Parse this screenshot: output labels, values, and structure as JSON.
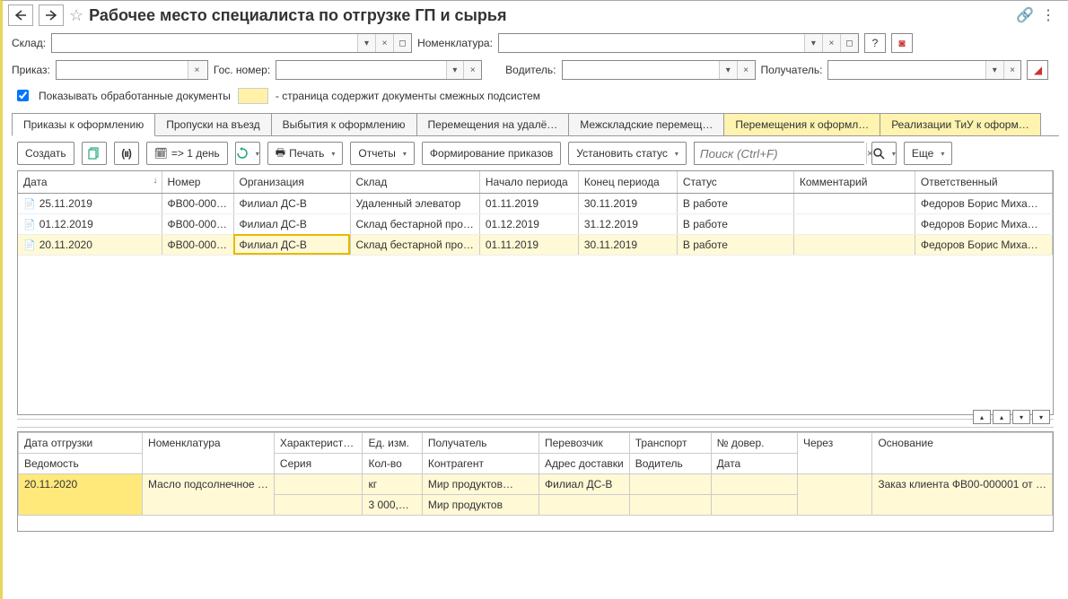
{
  "title": "Рабочее место специалиста по отгрузке ГП и сырья",
  "filters": {
    "warehouse_label": "Склад:",
    "nomenclature_label": "Номенклатура:",
    "order_label": "Приказ:",
    "gosnumber_label": "Гос. номер:",
    "driver_label": "Водитель:",
    "recipient_label": "Получатель:"
  },
  "checkbox": {
    "label": "Показывать обработанные документы"
  },
  "legend_text": "- страница содержит документы смежных подсистем",
  "tabs": [
    {
      "label": "Приказы к оформлению"
    },
    {
      "label": "Пропуски на въезд"
    },
    {
      "label": "Выбытия к оформлению"
    },
    {
      "label": "Перемещения на удалё…"
    },
    {
      "label": "Межскладские перемещ…"
    },
    {
      "label": "Перемещения к оформл…"
    },
    {
      "label": "Реализации ТиУ к оформ…"
    }
  ],
  "toolbar": {
    "create": "Создать",
    "oneday": "=> 1 день",
    "print": "Печать",
    "reports": "Отчеты",
    "form_orders": "Формирование приказов",
    "set_status": "Установить статус",
    "search_placeholder": "Поиск (Ctrl+F)",
    "more": "Еще"
  },
  "columns": [
    "Дата",
    "Номер",
    "Организация",
    "Склад",
    "Начало периода",
    "Конец периода",
    "Статус",
    "Комментарий",
    "Ответственный"
  ],
  "rows": [
    {
      "date": "25.11.2019",
      "num": "ФВ00-000…",
      "org": "Филиал ДС-В",
      "wh": "Удаленный элеватор",
      "start": "01.11.2019",
      "end": "30.11.2019",
      "status": "В работе",
      "comment": "",
      "resp": "Федоров Борис Миха…"
    },
    {
      "date": "01.12.2019",
      "num": "ФВ00-000…",
      "org": "Филиал ДС-В",
      "wh": "Склад бестарной про…",
      "start": "01.12.2019",
      "end": "31.12.2019",
      "status": "В работе",
      "comment": "",
      "resp": "Федоров Борис Миха…"
    },
    {
      "date": "20.11.2020",
      "num": "ФВ00-000…",
      "org": "Филиал ДС-В",
      "wh": "Склад бестарной про…",
      "start": "01.11.2019",
      "end": "30.11.2019",
      "status": "В работе",
      "comment": "",
      "resp": "Федоров Борис Миха…"
    }
  ],
  "bottom_header1": [
    "Дата отгрузки",
    "Номенклатура",
    "Характерист…",
    "Ед. изм.",
    "Получатель",
    "Перевозчик",
    "Транспорт",
    "№ довер.",
    "Через",
    "Основание"
  ],
  "bottom_header2": [
    "Ведомость",
    "",
    "Серия",
    "Кол-во",
    "Контрагент",
    "Адрес доставки",
    "Водитель",
    "Дата",
    "",
    ""
  ],
  "bottom_row": {
    "date": "20.11.2020",
    "nomen": "Масло подсолнечное …",
    "unit": "кг",
    "qty": "3 000,…",
    "recipient1": "Мир продуктов…",
    "recipient2": "Мир продуктов",
    "carrier": "Филиал ДС-В",
    "basis": "Заказ клиента ФВ00-000001 от …"
  }
}
